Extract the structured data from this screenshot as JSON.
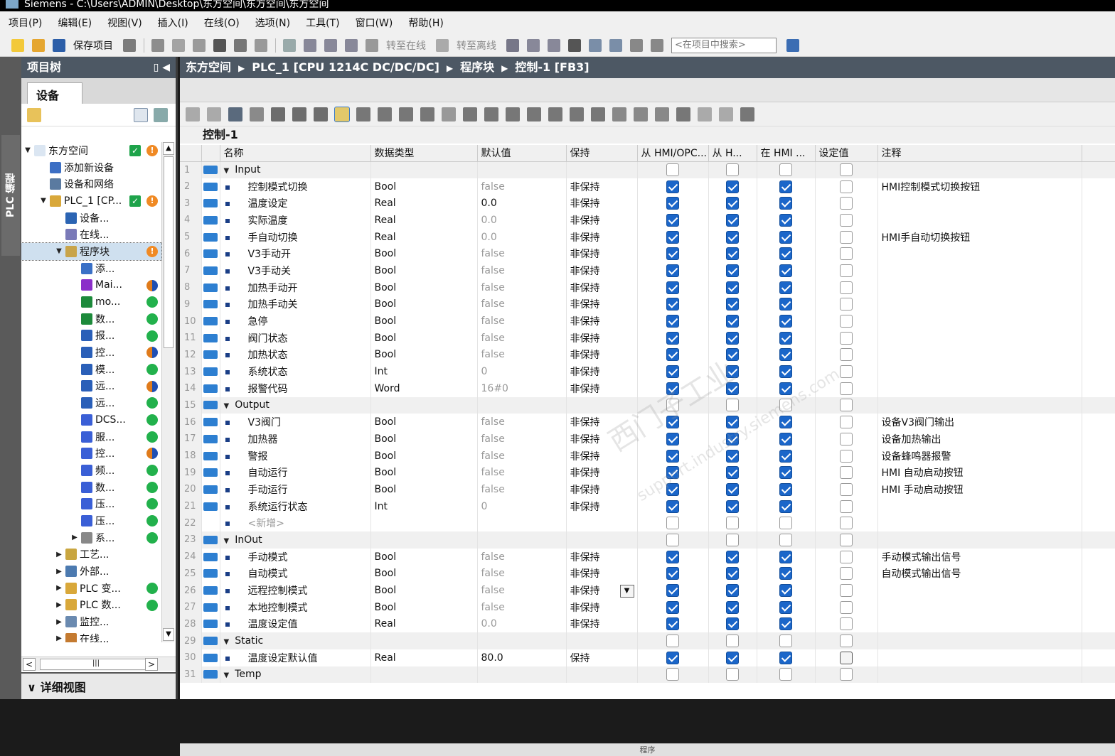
{
  "window": {
    "title": "Siemens  -  C:\\Users\\ADMIN\\Desktop\\东方空间\\东方空间\\东方空间"
  },
  "menu": [
    "项目(P)",
    "编辑(E)",
    "视图(V)",
    "插入(I)",
    "在线(O)",
    "选项(N)",
    "工具(T)",
    "窗口(W)",
    "帮助(H)"
  ],
  "toolbar": {
    "save_label": "保存项目",
    "go_online_label": "转至在线",
    "go_offline_label": "转至离线",
    "search_placeholder": "<在项目中搜索>"
  },
  "side_tab": {
    "label": "PLC 编程"
  },
  "project_tree": {
    "title": "项目树",
    "tab": "设备",
    "items": [
      {
        "label": "东方空间",
        "level": 0,
        "twisty": "▼",
        "status": "ok-warn"
      },
      {
        "label": "添加新设备",
        "level": 1,
        "twisty": "",
        "status": ""
      },
      {
        "label": "设备和网络",
        "level": 1,
        "twisty": "",
        "status": ""
      },
      {
        "label": "PLC_1 [CP...",
        "level": 1,
        "twisty": "▼",
        "status": "ok-warn"
      },
      {
        "label": "设备...",
        "level": 2,
        "twisty": "",
        "status": ""
      },
      {
        "label": "在线...",
        "level": 2,
        "twisty": "",
        "status": ""
      },
      {
        "label": "程序块",
        "level": 2,
        "twisty": "▼",
        "status": "warn",
        "selected": true
      },
      {
        "label": "添...",
        "level": 3,
        "twisty": "",
        "status": ""
      },
      {
        "label": "Mai...",
        "level": 3,
        "twisty": "",
        "status": "half"
      },
      {
        "label": "mo...",
        "level": 3,
        "twisty": "",
        "status": "green"
      },
      {
        "label": "数...",
        "level": 3,
        "twisty": "",
        "status": "green"
      },
      {
        "label": "报...",
        "level": 3,
        "twisty": "",
        "status": "green"
      },
      {
        "label": "控...",
        "level": 3,
        "twisty": "",
        "status": "half"
      },
      {
        "label": "模...",
        "level": 3,
        "twisty": "",
        "status": "green"
      },
      {
        "label": "远...",
        "level": 3,
        "twisty": "",
        "status": "half"
      },
      {
        "label": "远...",
        "level": 3,
        "twisty": "",
        "status": "green"
      },
      {
        "label": "DCS...",
        "level": 3,
        "twisty": "",
        "status": "green"
      },
      {
        "label": "服...",
        "level": 3,
        "twisty": "",
        "status": "green"
      },
      {
        "label": "控...",
        "level": 3,
        "twisty": "",
        "status": "half"
      },
      {
        "label": "频...",
        "level": 3,
        "twisty": "",
        "status": "green"
      },
      {
        "label": "数...",
        "level": 3,
        "twisty": "",
        "status": "green"
      },
      {
        "label": "压...",
        "level": 3,
        "twisty": "",
        "status": "green"
      },
      {
        "label": "压...",
        "level": 3,
        "twisty": "",
        "status": "green"
      },
      {
        "label": "系...",
        "level": 3,
        "twisty": "▶",
        "status": "green"
      },
      {
        "label": "工艺...",
        "level": 2,
        "twisty": "▶",
        "status": ""
      },
      {
        "label": "外部...",
        "level": 2,
        "twisty": "▶",
        "status": ""
      },
      {
        "label": "PLC 变...",
        "level": 2,
        "twisty": "▶",
        "status": "green"
      },
      {
        "label": "PLC 数...",
        "level": 2,
        "twisty": "▶",
        "status": "green"
      },
      {
        "label": "监控...",
        "level": 2,
        "twisty": "▶",
        "status": ""
      },
      {
        "label": "在线...",
        "level": 2,
        "twisty": "▶",
        "status": ""
      }
    ],
    "detail_view": "详细视图"
  },
  "breadcrumb": [
    "东方空间",
    "PLC_1 [CPU 1214C DC/DC/DC]",
    "程序块",
    "控制-1 [FB3]"
  ],
  "block_title": "控制-1",
  "columns": [
    "",
    "",
    "名称",
    "数据类型",
    "默认值",
    "保持",
    "从 HMI/OPC...",
    "从 H...",
    "在 HMI ...",
    "设定值",
    "注释"
  ],
  "rows": [
    {
      "n": "1",
      "kind": "section",
      "name": "Input",
      "type": "",
      "def": "",
      "ret": "",
      "c1": false,
      "c2": false,
      "c3": false,
      "c4": false,
      "comment": ""
    },
    {
      "n": "2",
      "kind": "var",
      "name": "控制模式切换",
      "type": "Bool",
      "def": "false",
      "ret": "非保持",
      "c1": true,
      "c2": true,
      "c3": true,
      "c4": false,
      "comment": "HMI控制模式切换按钮"
    },
    {
      "n": "3",
      "kind": "var",
      "name": "温度设定",
      "type": "Real",
      "def": "0.0",
      "ret": "非保持",
      "c1": true,
      "c2": true,
      "c3": true,
      "c4": false,
      "comment": "",
      "defBlack": true
    },
    {
      "n": "4",
      "kind": "var",
      "name": "实际温度",
      "type": "Real",
      "def": "0.0",
      "ret": "非保持",
      "c1": true,
      "c2": true,
      "c3": true,
      "c4": false,
      "comment": ""
    },
    {
      "n": "5",
      "kind": "var",
      "name": "手自动切换",
      "type": "Real",
      "def": "0.0",
      "ret": "非保持",
      "c1": true,
      "c2": true,
      "c3": true,
      "c4": false,
      "comment": "HMI手自动切换按钮"
    },
    {
      "n": "6",
      "kind": "var",
      "name": "V3手动开",
      "type": "Bool",
      "def": "false",
      "ret": "非保持",
      "c1": true,
      "c2": true,
      "c3": true,
      "c4": false,
      "comment": ""
    },
    {
      "n": "7",
      "kind": "var",
      "name": "V3手动关",
      "type": "Bool",
      "def": "false",
      "ret": "非保持",
      "c1": true,
      "c2": true,
      "c3": true,
      "c4": false,
      "comment": ""
    },
    {
      "n": "8",
      "kind": "var",
      "name": "加热手动开",
      "type": "Bool",
      "def": "false",
      "ret": "非保持",
      "c1": true,
      "c2": true,
      "c3": true,
      "c4": false,
      "comment": ""
    },
    {
      "n": "9",
      "kind": "var",
      "name": "加热手动关",
      "type": "Bool",
      "def": "false",
      "ret": "非保持",
      "c1": true,
      "c2": true,
      "c3": true,
      "c4": false,
      "comment": ""
    },
    {
      "n": "10",
      "kind": "var",
      "name": "急停",
      "type": "Bool",
      "def": "false",
      "ret": "非保持",
      "c1": true,
      "c2": true,
      "c3": true,
      "c4": false,
      "comment": ""
    },
    {
      "n": "11",
      "kind": "var",
      "name": "阀门状态",
      "type": "Bool",
      "def": "false",
      "ret": "非保持",
      "c1": true,
      "c2": true,
      "c3": true,
      "c4": false,
      "comment": ""
    },
    {
      "n": "12",
      "kind": "var",
      "name": "加热状态",
      "type": "Bool",
      "def": "false",
      "ret": "非保持",
      "c1": true,
      "c2": true,
      "c3": true,
      "c4": false,
      "comment": ""
    },
    {
      "n": "13",
      "kind": "var",
      "name": "系统状态",
      "type": "Int",
      "def": "0",
      "ret": "非保持",
      "c1": true,
      "c2": true,
      "c3": true,
      "c4": false,
      "comment": ""
    },
    {
      "n": "14",
      "kind": "var",
      "name": "报警代码",
      "type": "Word",
      "def": "16#0",
      "ret": "非保持",
      "c1": true,
      "c2": true,
      "c3": true,
      "c4": false,
      "comment": ""
    },
    {
      "n": "15",
      "kind": "section",
      "name": "Output",
      "type": "",
      "def": "",
      "ret": "",
      "c1": false,
      "c2": false,
      "c3": false,
      "c4": false,
      "comment": ""
    },
    {
      "n": "16",
      "kind": "var",
      "name": "V3阀门",
      "type": "Bool",
      "def": "false",
      "ret": "非保持",
      "c1": true,
      "c2": true,
      "c3": true,
      "c4": false,
      "comment": "设备V3阀门输出"
    },
    {
      "n": "17",
      "kind": "var",
      "name": "加热器",
      "type": "Bool",
      "def": "false",
      "ret": "非保持",
      "c1": true,
      "c2": true,
      "c3": true,
      "c4": false,
      "comment": "设备加热输出"
    },
    {
      "n": "18",
      "kind": "var",
      "name": "警报",
      "type": "Bool",
      "def": "false",
      "ret": "非保持",
      "c1": true,
      "c2": true,
      "c3": true,
      "c4": false,
      "comment": "设备蜂鸣器报警"
    },
    {
      "n": "19",
      "kind": "var",
      "name": "自动运行",
      "type": "Bool",
      "def": "false",
      "ret": "非保持",
      "c1": true,
      "c2": true,
      "c3": true,
      "c4": false,
      "comment": "HMI 自动启动按钮"
    },
    {
      "n": "20",
      "kind": "var",
      "name": "手动运行",
      "type": "Bool",
      "def": "false",
      "ret": "非保持",
      "c1": true,
      "c2": true,
      "c3": true,
      "c4": false,
      "comment": "HMI 手动启动按钮"
    },
    {
      "n": "21",
      "kind": "var",
      "name": "系统运行状态",
      "type": "Int",
      "def": "0",
      "ret": "非保持",
      "c1": true,
      "c2": true,
      "c3": true,
      "c4": false,
      "comment": ""
    },
    {
      "n": "22",
      "kind": "new",
      "name": "<新增>",
      "type": "",
      "def": "",
      "ret": "",
      "c1": false,
      "c2": false,
      "c3": false,
      "c4": false,
      "comment": ""
    },
    {
      "n": "23",
      "kind": "section",
      "name": "InOut",
      "type": "",
      "def": "",
      "ret": "",
      "c1": false,
      "c2": false,
      "c3": false,
      "c4": false,
      "comment": ""
    },
    {
      "n": "24",
      "kind": "var",
      "name": "手动模式",
      "type": "Bool",
      "def": "false",
      "ret": "非保持",
      "c1": true,
      "c2": true,
      "c3": true,
      "c4": false,
      "comment": "手动模式输出信号"
    },
    {
      "n": "25",
      "kind": "var",
      "name": "自动模式",
      "type": "Bool",
      "def": "false",
      "ret": "非保持",
      "c1": true,
      "c2": true,
      "c3": true,
      "c4": false,
      "comment": "自动模式输出信号"
    },
    {
      "n": "26",
      "kind": "var",
      "name": "远程控制模式",
      "type": "Bool",
      "def": "false",
      "ret": "非保持",
      "c1": true,
      "c2": true,
      "c3": true,
      "c4": false,
      "comment": "",
      "editing": true
    },
    {
      "n": "27",
      "kind": "var",
      "name": "本地控制模式",
      "type": "Bool",
      "def": "false",
      "ret": "非保持",
      "c1": true,
      "c2": true,
      "c3": true,
      "c4": false,
      "comment": ""
    },
    {
      "n": "28",
      "kind": "var",
      "name": "温度设定值",
      "type": "Real",
      "def": "0.0",
      "ret": "非保持",
      "c1": true,
      "c2": true,
      "c3": true,
      "c4": false,
      "comment": ""
    },
    {
      "n": "29",
      "kind": "section",
      "name": "Static",
      "type": "",
      "def": "",
      "ret": "",
      "c1": false,
      "c2": false,
      "c3": false,
      "c4": false,
      "comment": ""
    },
    {
      "n": "30",
      "kind": "var",
      "name": "温度设定默认值",
      "type": "Real",
      "def": "80.0",
      "ret": "保持",
      "c1": true,
      "c2": true,
      "c3": true,
      "c4": false,
      "comment": "",
      "defBlack": true,
      "darkCb": true
    },
    {
      "n": "31",
      "kind": "section",
      "name": "Temp",
      "type": "",
      "def": "",
      "ret": "",
      "c1": false,
      "c2": false,
      "c3": false,
      "c4": false,
      "comment": ""
    }
  ],
  "watermark": {
    "line1": "西门子工业",
    "line2": "support.industry.siemens.com"
  },
  "bottom_label": "程序"
}
